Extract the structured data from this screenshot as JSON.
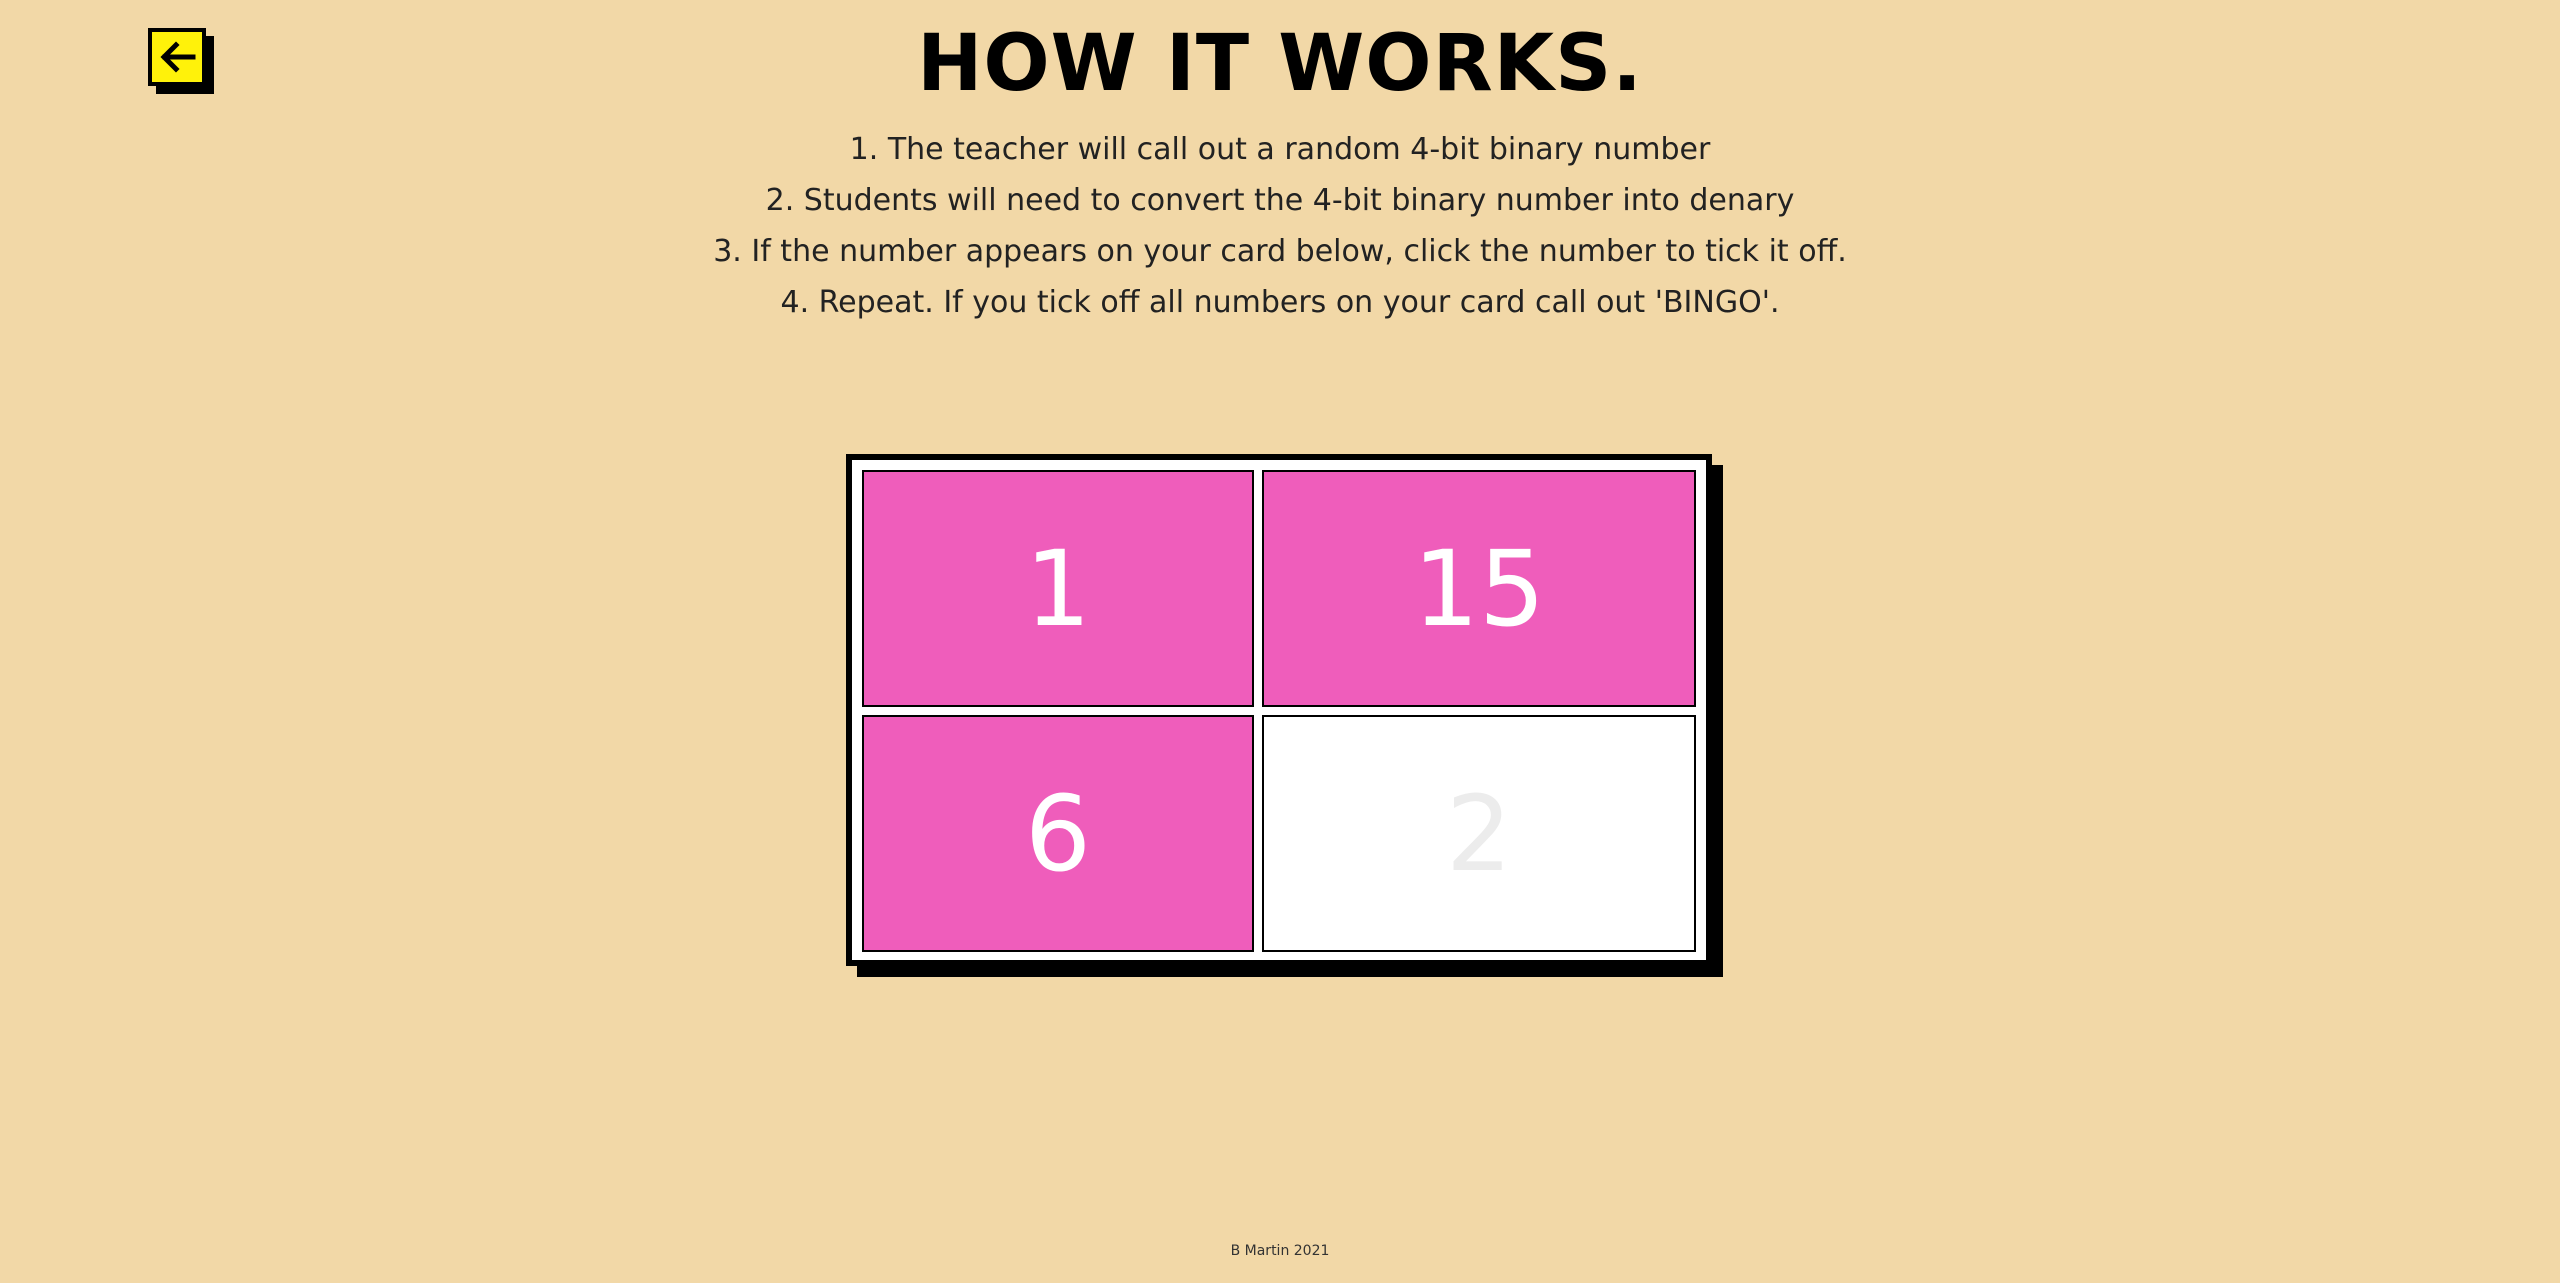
{
  "header": {
    "back_icon": "arrow-left-icon",
    "title": "HOW IT WORKS."
  },
  "instructions": [
    "1. The teacher will call out a random 4-bit binary number",
    "2. Students will need to convert the 4-bit binary number into denary",
    "3. If the number appears on your card below, click the number to tick it off.",
    "4. Repeat. If you tick off all numbers on your card call out 'BINGO'."
  ],
  "bingo_card": {
    "cells": [
      {
        "value": "1",
        "ticked": true
      },
      {
        "value": "15",
        "ticked": true
      },
      {
        "value": "6",
        "ticked": true
      },
      {
        "value": "2",
        "ticked": false
      }
    ]
  },
  "colors": {
    "background": "#f2d8a7",
    "ticked": "#ef5dbb",
    "back_button": "#fff20a"
  },
  "footer": {
    "credit": "B Martin 2021"
  }
}
